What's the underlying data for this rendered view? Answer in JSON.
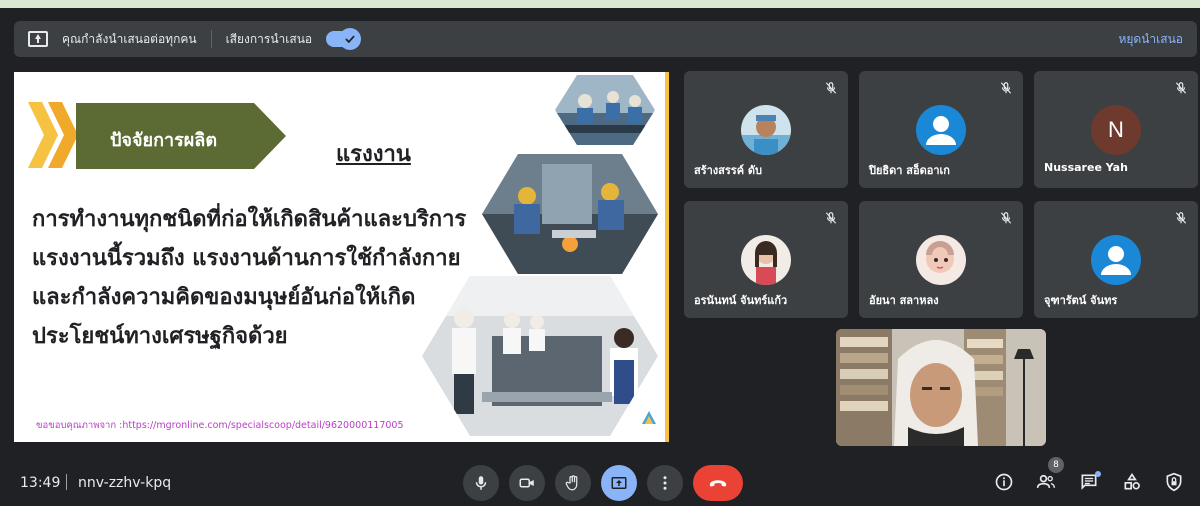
{
  "presenting_bar": {
    "status_text": "คุณกำลังนำเสนอต่อทุกคน",
    "audio_label": "เสียงการนำเสนอ",
    "stop_label": "หยุดนำเสนอ",
    "audio_toggle_on": true
  },
  "slide": {
    "title": "ปัจจัยการผลิต",
    "heading": "แรงงาน",
    "body_lines": [
      "การทำงานทุกชนิดที่ก่อให้เกิดสินค้าและบริการ",
      "แรงงานนี้รวมถึง แรงงานด้านการใช้กำลังกาย",
      "และกำลังความคิดของมนุษย์อันก่อให้เกิด",
      "ประโยชน์ทางเศรษฐกิจด้วย"
    ],
    "credit": "ขอขอบคุณภาพจาก :https://mgronline.com/specialscoop/detail/9620000117005"
  },
  "participants": [
    {
      "name": "สร้างสรรค์ ดับ",
      "avatar": "photo-man",
      "muted": true
    },
    {
      "name": "ปิยธิดา สอ็ดอาเก",
      "avatar": "default-person",
      "muted": true
    },
    {
      "name": "Nussaree Yah",
      "avatar": "letter",
      "letter": "N",
      "muted": true
    },
    {
      "name": "อรนันทน์ จันทร์แก้ว",
      "avatar": "photo-woman",
      "muted": true
    },
    {
      "name": "อัยนา สลาหลง",
      "avatar": "photo-cartoon",
      "muted": true
    },
    {
      "name": "จุฑารัตน์ จันทร",
      "avatar": "default-person",
      "muted": true
    }
  ],
  "meeting": {
    "time": "13:49",
    "code": "nnv-zzhv-kpq",
    "participant_count": "8"
  },
  "colors": {
    "background": "#202124",
    "panel": "#3c4043",
    "accent": "#8ab4f8",
    "hangup": "#ea4335",
    "avatar_blue": "#1a88d6",
    "avatar_brown": "#6d3a2d"
  },
  "icons": {
    "controls": [
      "mic-icon",
      "camera-icon",
      "raise-hand-icon",
      "present-screen-icon",
      "more-options-icon",
      "hang-up-icon"
    ],
    "right": [
      "info-icon",
      "people-icon",
      "chat-icon",
      "activities-icon",
      "host-controls-icon"
    ]
  }
}
